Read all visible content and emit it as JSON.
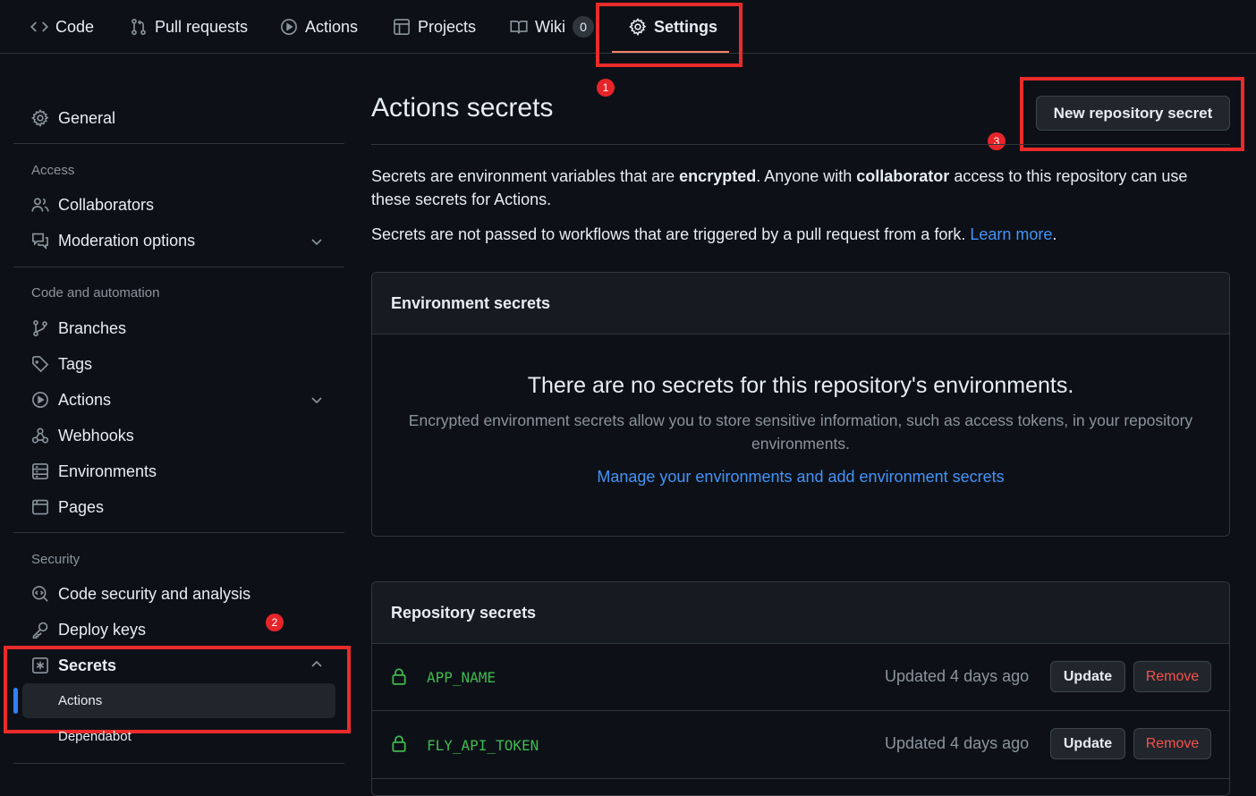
{
  "topnav": {
    "tabs": [
      {
        "label": "Code",
        "icon": "code-icon"
      },
      {
        "label": "Pull requests",
        "icon": "git-pull-request-icon"
      },
      {
        "label": "Actions",
        "icon": "play-icon"
      },
      {
        "label": "Projects",
        "icon": "table-icon"
      },
      {
        "label": "Wiki",
        "icon": "book-icon",
        "count": "0"
      },
      {
        "label": "Settings",
        "icon": "gear-icon",
        "active": true
      }
    ]
  },
  "annotations": {
    "badge1": "1",
    "badge2": "2",
    "badge3": "3",
    "color": "#ea2b2b"
  },
  "sidebar": {
    "general": "General",
    "access_heading": "Access",
    "collaborators": "Collaborators",
    "moderation": "Moderation options",
    "code_heading": "Code and automation",
    "branches": "Branches",
    "tags": "Tags",
    "actions": "Actions",
    "webhooks": "Webhooks",
    "environments": "Environments",
    "pages": "Pages",
    "security_heading": "Security",
    "code_security": "Code security and analysis",
    "deploy_keys": "Deploy keys",
    "secrets": "Secrets",
    "secrets_actions": "Actions",
    "secrets_dependabot": "Dependabot"
  },
  "main": {
    "title": "Actions secrets",
    "new_secret_button": "New repository secret",
    "intro_p1_a": "Secrets are environment variables that are ",
    "intro_p1_b": "encrypted",
    "intro_p1_c": ". Anyone with ",
    "intro_p1_d": "collaborator",
    "intro_p1_e": " access to this repository can use these secrets for Actions.",
    "intro_p2": "Secrets are not passed to workflows that are triggered by a pull request from a fork. ",
    "learn_more": "Learn more",
    "period": ".",
    "env_secrets": {
      "heading": "Environment secrets",
      "empty_title": "There are no secrets for this repository's environments.",
      "empty_desc": "Encrypted environment secrets allow you to store sensitive information, such as access tokens, in your repository environments.",
      "manage_link": "Manage your environments and add environment secrets"
    },
    "repo_secrets": {
      "heading": "Repository secrets",
      "rows": [
        {
          "name": "APP_NAME",
          "updated": "Updated 4 days ago",
          "update": "Update",
          "remove": "Remove"
        },
        {
          "name": "FLY_API_TOKEN",
          "updated": "Updated 4 days ago",
          "update": "Update",
          "remove": "Remove"
        }
      ]
    }
  },
  "colors": {
    "accent": "#4493f8",
    "success": "#3fb950",
    "danger": "#f85149",
    "tab_underline": "#f78166"
  }
}
